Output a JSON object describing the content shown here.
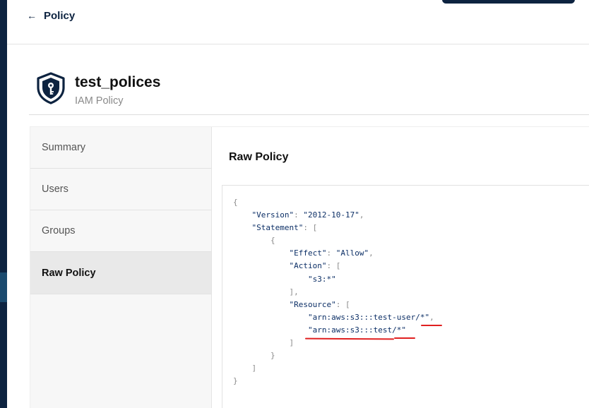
{
  "header": {
    "back_label": "Policy"
  },
  "policy": {
    "name": "test_polices",
    "type": "IAM Policy"
  },
  "tabs": [
    {
      "label": "Summary",
      "active": false
    },
    {
      "label": "Users",
      "active": false
    },
    {
      "label": "Groups",
      "active": false
    },
    {
      "label": "Raw Policy",
      "active": true
    }
  ],
  "raw_policy": {
    "title": "Raw Policy",
    "version_key": "\"Version\"",
    "version_value": "\"2012-10-17\"",
    "statement_key": "\"Statement\"",
    "effect_key": "\"Effect\"",
    "effect_value": "\"Allow\"",
    "action_key": "\"Action\"",
    "action_value": "\"s3:*\"",
    "resource_key": "\"Resource\"",
    "resources": [
      "\"arn:aws:s3:::test-user/*\"",
      "\"arn:aws:s3:::test/*\""
    ]
  },
  "icons": {
    "back": "arrow-left-icon",
    "policy": "shield-key-icon"
  },
  "colors": {
    "nav": "#0d2340",
    "code_key": "#0c2f66",
    "annotation": "#e02020"
  }
}
